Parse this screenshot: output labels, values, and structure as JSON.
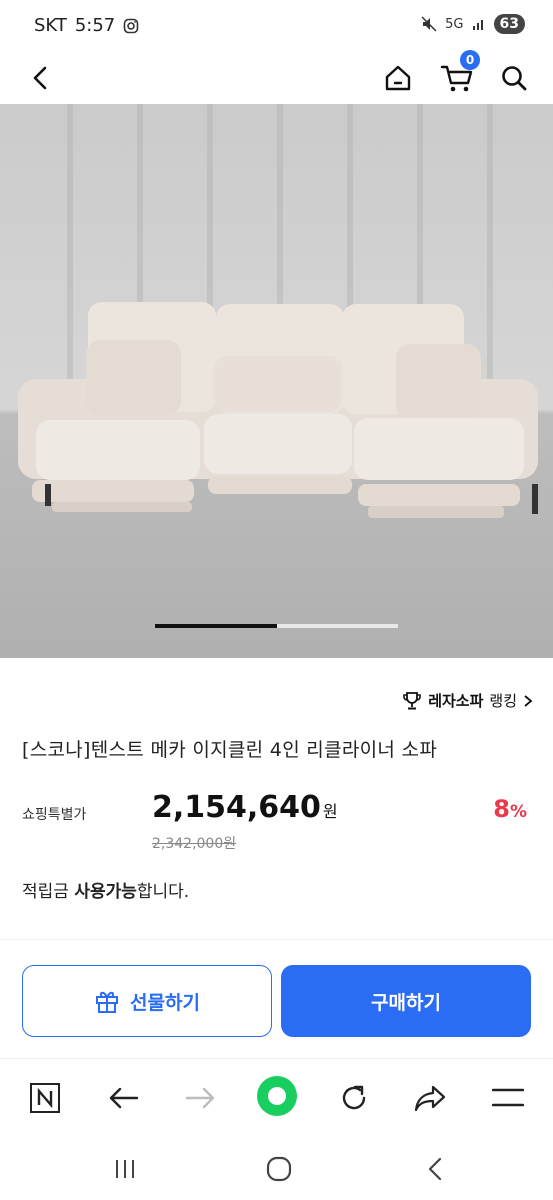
{
  "status_bar": {
    "carrier": "SKT",
    "time": "5:57",
    "network": "5G",
    "battery": "63"
  },
  "header": {
    "cart_count": "0"
  },
  "product": {
    "ranking_category": "레자소파",
    "ranking_label": "랭킹",
    "title": "[스코나]텐스트 메카 이지클린 4인 리클라이너 소파",
    "price_label": "쇼핑특별가",
    "price": "2,154,640",
    "price_unit": "원",
    "original_price": "2,342,000원",
    "discount": "8",
    "discount_unit": "%",
    "points_prefix": "적립금 ",
    "points_bold": "사용가능",
    "points_suffix": "합니다."
  },
  "buttons": {
    "gift": "선물하기",
    "buy": "구매하기"
  },
  "gallery": {
    "position_fraction": 0.5
  },
  "colors": {
    "accent": "#2a6df4",
    "discount": "#e83a4a"
  }
}
